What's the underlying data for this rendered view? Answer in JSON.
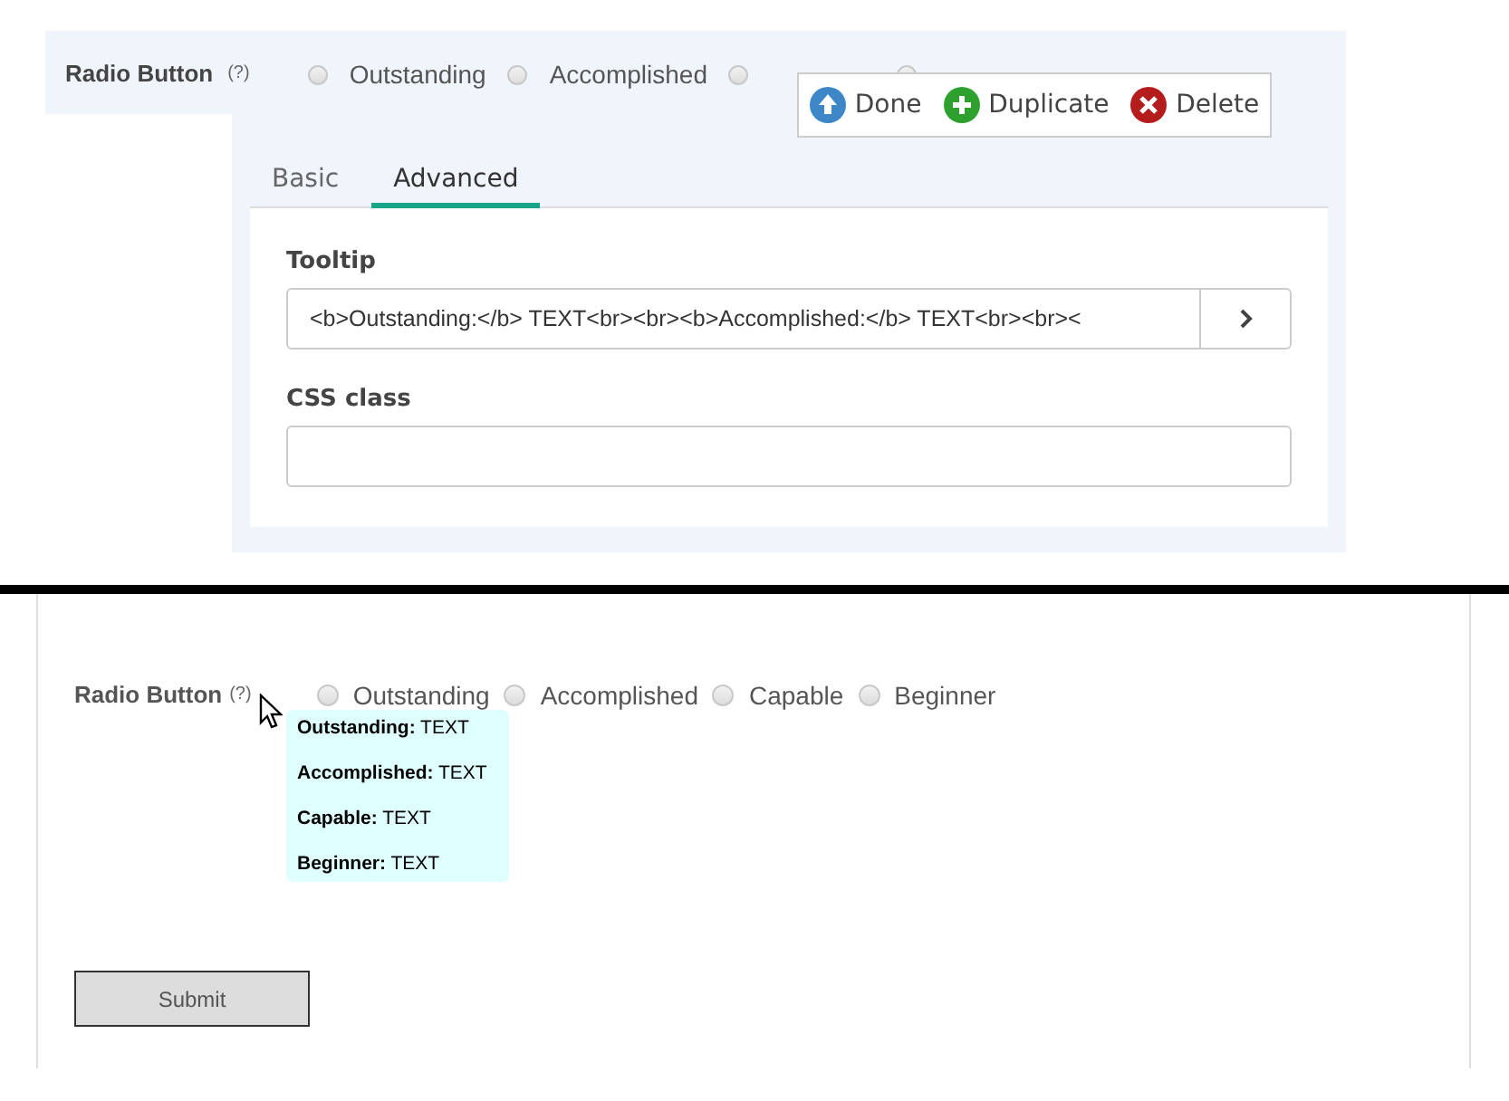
{
  "editor": {
    "field": {
      "label": "Radio Button",
      "help": "(?)",
      "options": [
        {
          "label": "Outstanding",
          "selected": false
        },
        {
          "label": "Accomplished",
          "selected": false
        },
        {
          "selected": false
        },
        {
          "selected": false
        }
      ]
    },
    "toolbar": [
      {
        "kind": "done",
        "label": "Done"
      },
      {
        "kind": "duplicate",
        "label": "Duplicate"
      },
      {
        "kind": "delete",
        "label": "Delete"
      }
    ],
    "tabs": [
      {
        "label": "Basic",
        "selected": false
      },
      {
        "label": "Advanced",
        "selected": true
      }
    ],
    "fields": [
      {
        "label": "Tooltip",
        "value": "<b>Outstanding:</b> TEXT<br><br><b>Accomplished:</b> TEXT<br><br><",
        "kind": "expand"
      },
      {
        "label": "CSS class",
        "kind": "plain"
      }
    ]
  },
  "preview": {
    "field": {
      "label": "Radio Button",
      "help": "(?)",
      "options": [
        {
          "label": "Outstanding",
          "selected": false
        },
        {
          "label": "Accomplished",
          "selected": false
        },
        {
          "label": "Capable",
          "selected": false
        },
        {
          "label": "Beginner",
          "selected": false
        }
      ]
    },
    "tooltip": [
      "**Outstanding:** TEXT",
      "**Accomplished:** TEXT",
      "**Capable:** TEXT",
      "**Beginner:** TEXT"
    ],
    "submit": "Submit"
  }
}
